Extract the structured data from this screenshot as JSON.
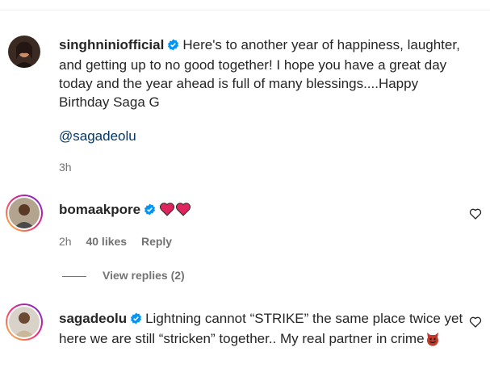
{
  "comments": [
    {
      "username": "singhniniofficial",
      "text": "Here's to another year of happiness, laughter, and getting up to no good together! I hope you have a great day today and the year ahead is full of many blessings....Happy Birthday Saga G",
      "mention": "@sagadeolu",
      "time": "3h"
    },
    {
      "username": "bomaakpore",
      "time": "2h",
      "likes": "40 likes",
      "reply_label": "Reply",
      "view_replies": "View replies (2)"
    },
    {
      "username": "sagadeolu",
      "text": "Lightning cannot “STRIKE” the same place twice yet here we are still “stricken” together.. My real partner in crime"
    }
  ],
  "icons": {
    "verified": "verified-badge-icon",
    "heart_emoji": "red-heart-emoji",
    "devil_emoji": "smiling-devil-emoji",
    "like": "heart-outline-icon"
  },
  "colors": {
    "verified": "#0095f6",
    "mention": "#00376b",
    "meta": "#737373",
    "emoji_heart": "#e0245e",
    "devil": "#c0392b"
  }
}
